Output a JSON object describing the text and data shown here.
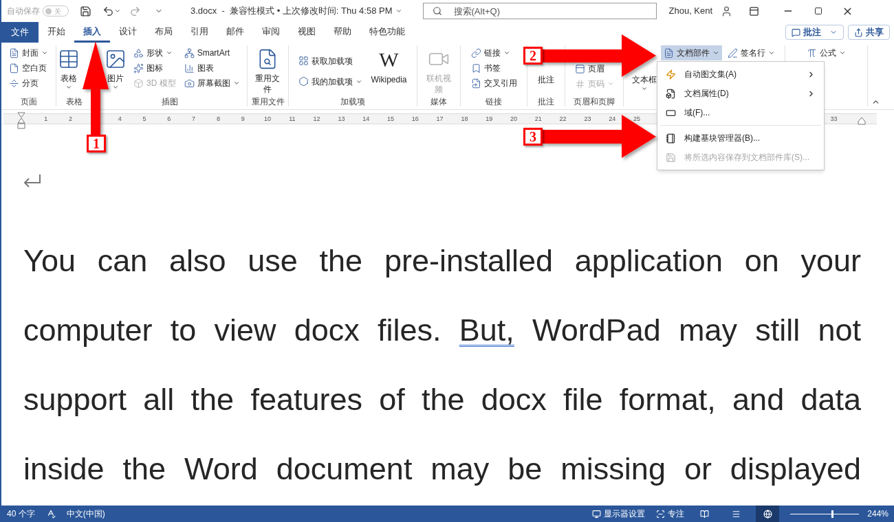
{
  "title_bar": {
    "autosave_label": "自动保存",
    "autosave_on": false,
    "autosave_state": "关",
    "document_title": "3.docx  -  兼容性模式 • 上次修改时间: Thu 4:58 PM",
    "search_placeholder": "搜索(Alt+Q)",
    "user_name": "Zhou, Kent"
  },
  "tabs": [
    {
      "label": "文件",
      "kind": "file",
      "selected": false
    },
    {
      "label": "开始",
      "kind": "tab",
      "selected": false
    },
    {
      "label": "插入",
      "kind": "tab",
      "selected": true
    },
    {
      "label": "设计",
      "kind": "tab",
      "selected": false
    },
    {
      "label": "布局",
      "kind": "tab",
      "selected": false
    },
    {
      "label": "引用",
      "kind": "tab",
      "selected": false
    },
    {
      "label": "邮件",
      "kind": "tab",
      "selected": false
    },
    {
      "label": "审阅",
      "kind": "tab",
      "selected": false
    },
    {
      "label": "视图",
      "kind": "tab",
      "selected": false
    },
    {
      "label": "帮助",
      "kind": "tab",
      "selected": false
    },
    {
      "label": "特色功能",
      "kind": "tab",
      "selected": false
    }
  ],
  "ribbon_buttons": [
    {
      "label": "批注",
      "kind": "comments"
    },
    {
      "label": "共享",
      "kind": "share"
    }
  ],
  "ribbon_groups": [
    {
      "label": "页面",
      "columns": [
        [
          {
            "label": "封面",
            "kind": "small",
            "caret": true
          },
          {
            "label": "空白页",
            "kind": "small"
          },
          {
            "label": "分页",
            "kind": "small"
          }
        ]
      ]
    },
    {
      "label": "表格",
      "columns": [
        [
          {
            "label": "表格",
            "kind": "large",
            "caret": true
          }
        ]
      ]
    },
    {
      "label": "插图",
      "columns": [
        [
          {
            "label": "图片",
            "kind": "large",
            "caret": true
          }
        ],
        [
          {
            "label": "形状",
            "kind": "small",
            "caret": true
          },
          {
            "label": "图标",
            "kind": "small"
          },
          {
            "label": "3D 模型",
            "kind": "small",
            "disabled": true
          }
        ],
        [
          {
            "label": "SmartArt",
            "kind": "small"
          },
          {
            "label": "图表",
            "kind": "small"
          },
          {
            "label": "屏幕截图",
            "kind": "small",
            "caret": true
          }
        ]
      ]
    },
    {
      "label": "重用文件",
      "columns": [
        [
          {
            "label": "重用文件",
            "kind": "large"
          }
        ]
      ]
    },
    {
      "label": "加载项",
      "columns": [
        [
          {
            "label": "获取加载项",
            "kind": "small"
          },
          {
            "label": "我的加载项",
            "kind": "small",
            "caret": true
          }
        ],
        [
          {
            "label": "Wikipedia",
            "kind": "logo",
            "mark": "W"
          }
        ]
      ]
    },
    {
      "label": "媒体",
      "columns": [
        [
          {
            "label": "联机视频",
            "kind": "large",
            "disabled": true
          }
        ]
      ]
    },
    {
      "label": "链接",
      "columns": [
        [
          {
            "label": "链接",
            "kind": "small",
            "caret": true
          },
          {
            "label": "书签",
            "kind": "small"
          },
          {
            "label": "交叉引用",
            "kind": "small"
          }
        ]
      ]
    },
    {
      "label": "批注",
      "columns": [
        [
          {
            "label": "批注",
            "kind": "large"
          }
        ]
      ]
    },
    {
      "label": "页眉和页脚",
      "columns": [
        [
          {
            "label": "页眉",
            "kind": "small"
          },
          {
            "label": "页码",
            "kind": "small",
            "caret": true,
            "disabled": true
          }
        ]
      ]
    },
    {
      "columns": [
        [
          {
            "label": "文本框",
            "kind": "large",
            "caret": true
          }
        ],
        [
          {
            "label": "文档部件",
            "kind": "small",
            "caret": true,
            "expanded": true
          }
        ],
        [
          {
            "label": "签名行",
            "kind": "small",
            "caret": true
          }
        ]
      ]
    },
    {
      "columns": [
        [
          {
            "label": "公式",
            "kind": "small",
            "caret": true
          }
        ]
      ]
    }
  ],
  "dropdown": {
    "items": [
      {
        "label": "自动图文集(A)",
        "submenu": true,
        "disabled": false
      },
      {
        "label": "文档属性(D)",
        "submenu": true,
        "disabled": false
      },
      {
        "label": "域(F)...",
        "submenu": false,
        "disabled": false
      },
      {
        "label": "构建基块管理器(B)...",
        "submenu": false,
        "disabled": false
      },
      {
        "label": "将所选内容保存到文档部件库(S)...",
        "submenu": false,
        "disabled": true
      }
    ]
  },
  "ruler": {
    "numbers": [
      "1",
      "2",
      "4",
      "5",
      "6",
      "7",
      "8",
      "9",
      "10",
      "11",
      "12",
      "13",
      "14",
      "15",
      "16",
      "17",
      "18",
      "19",
      "20",
      "21",
      "22",
      "23",
      "24",
      "25",
      "33"
    ]
  },
  "document": {
    "lines": [
      [
        {
          "text": "You can also use the pre-installed application on your",
          "flagged": false
        }
      ],
      [
        {
          "text": "computer to view docx files. ",
          "flagged": false
        },
        {
          "text": "But,",
          "flagged": true
        },
        {
          "text": " WordPad may still not",
          "flagged": false
        }
      ],
      [
        {
          "text": "support all the features of the docx file format, and data",
          "flagged": false
        }
      ],
      [
        {
          "text": "inside the Word document may be missing or displayed",
          "flagged": false
        }
      ]
    ]
  },
  "status_bar": {
    "word_count": "40 个字",
    "language": "中文(中国)",
    "display_settings": "显示器设置",
    "focus": "专注",
    "views": [
      {
        "selected": false
      },
      {
        "selected": false
      },
      {
        "selected": true
      }
    ],
    "zoom": {
      "level": 0.62
    },
    "zoom_text": "244%"
  },
  "annotations": [
    {
      "label": "1"
    },
    {
      "label": "2"
    },
    {
      "label": "3"
    }
  ]
}
